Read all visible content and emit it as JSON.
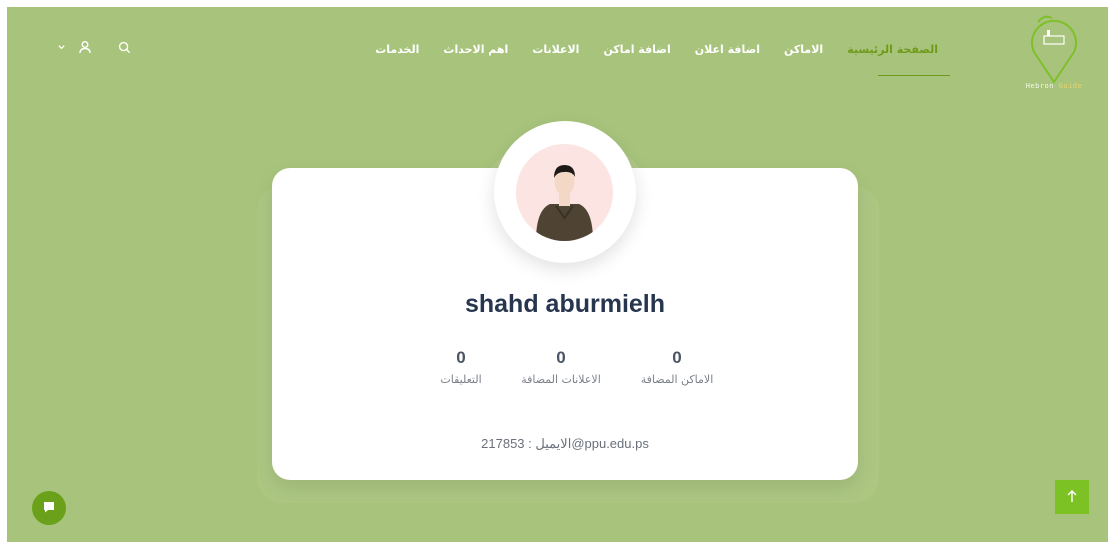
{
  "header": {
    "logo_text_main": "Hebron",
    "logo_text_alt": "Guide",
    "nav": [
      {
        "label": "الصفحة الرئيسية",
        "active": true
      },
      {
        "label": "الاماكن",
        "active": false
      },
      {
        "label": "اضافة اعلان",
        "active": false
      },
      {
        "label": "اضافة اماكن",
        "active": false
      },
      {
        "label": "الاعلانات",
        "active": false
      },
      {
        "label": "اهم الاحداث",
        "active": false
      },
      {
        "label": "الخدمات",
        "active": false
      }
    ],
    "icons": [
      "chevron-down-icon",
      "user-icon",
      "search-icon"
    ]
  },
  "profile": {
    "name": "shahd aburmielh",
    "stats": [
      {
        "value": "0",
        "label": "الاماكن المضافة"
      },
      {
        "value": "0",
        "label": "الاعلانات المضافة"
      },
      {
        "value": "0",
        "label": "التعليقات"
      }
    ],
    "email": "الايميل : 217853@ppu.edu.ps"
  },
  "colors": {
    "background": "#a8c47c",
    "accent": "#6f9a1a",
    "heading": "#27364e",
    "button_green": "#7cc225"
  }
}
